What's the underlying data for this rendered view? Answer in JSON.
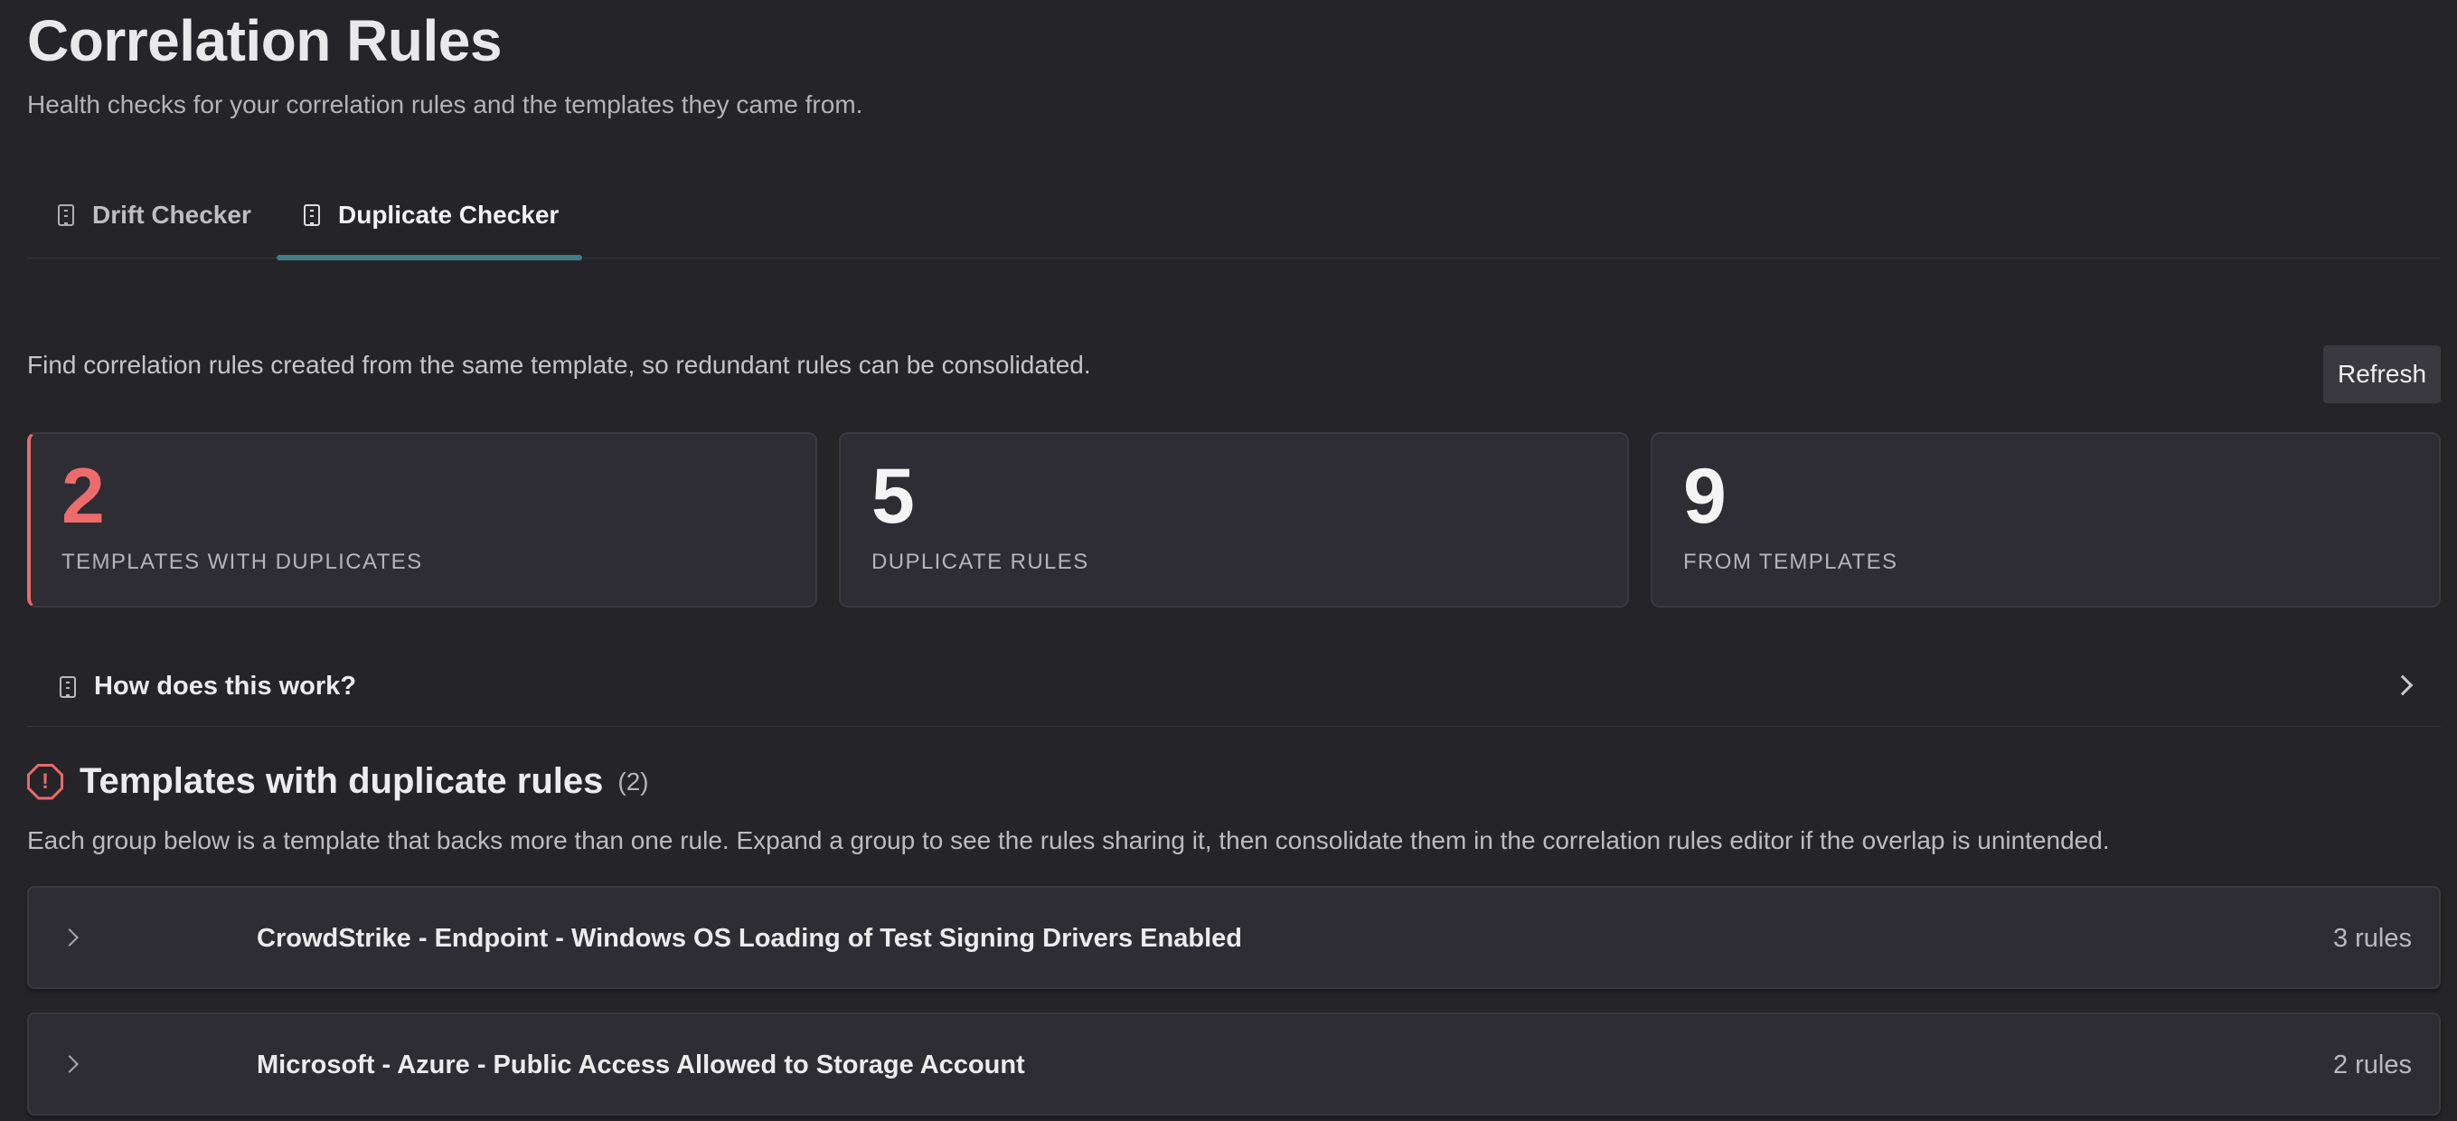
{
  "header": {
    "title": "Correlation Rules",
    "subtitle": "Health checks for your correlation rules and the templates they came from."
  },
  "tabs": [
    {
      "label": "Drift Checker",
      "icon": "document-icon",
      "active": false
    },
    {
      "label": "Duplicate Checker",
      "icon": "document-icon",
      "active": true
    }
  ],
  "colors": {
    "background": "#252429",
    "card": "#2e2d33",
    "accent_tab": "#3c7f86",
    "alert": "#e86a6a"
  },
  "main": {
    "intro": "Find correlation rules created from the same template, so redundant rules can be consolidated.",
    "refresh_label": "Refresh",
    "stats": [
      {
        "value": "2",
        "label": "TEMPLATES WITH DUPLICATES"
      },
      {
        "value": "5",
        "label": "DUPLICATE RULES"
      },
      {
        "value": "9",
        "label": "FROM TEMPLATES"
      }
    ],
    "howto_label": "How does this work?",
    "section": {
      "title": "Templates with duplicate rules",
      "count": "(2)",
      "icon": "alert-octagon-icon",
      "description": "Each group below is a template that backs more than one rule. Expand a group to see the rules sharing it, then consolidate them in the correlation rules editor if the overlap is unintended."
    },
    "groups": [
      {
        "title": "CrowdStrike - Endpoint - Windows OS Loading of Test Signing Drivers Enabled",
        "count": "3 rules"
      },
      {
        "title": "Microsoft - Azure - Public Access Allowed to Storage Account",
        "count": "2 rules"
      }
    ]
  }
}
